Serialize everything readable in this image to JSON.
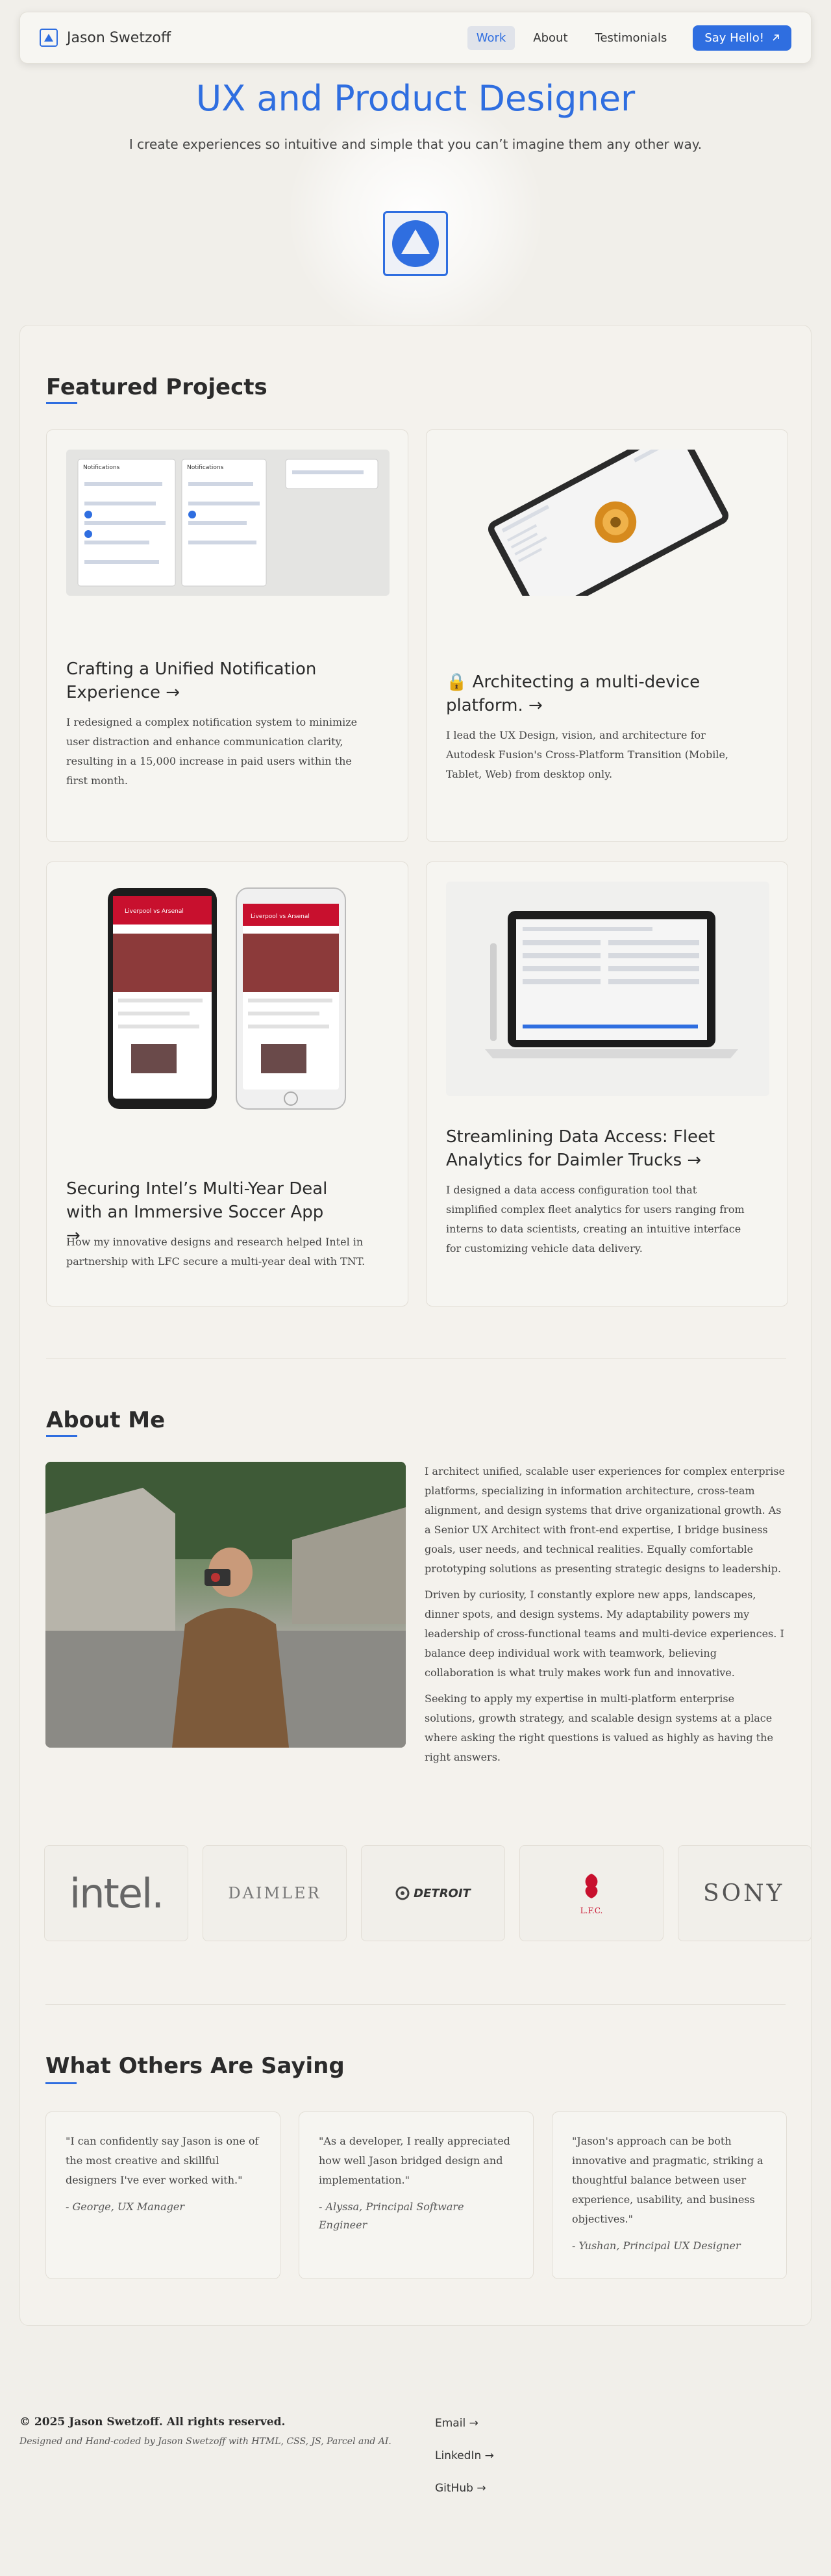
{
  "nav": {
    "name": "Jason Swetzoff",
    "links": [
      "Work",
      "About",
      "Testimonials"
    ],
    "cta": "Say Hello!",
    "cta_icon": "arrow-up-right-icon"
  },
  "hero": {
    "title": "UX and Product Designer",
    "subtitle": "I create experiences so intuitive and simple that you can’t imagine them any other way."
  },
  "featured": {
    "title": "Featured Projects",
    "projects": [
      {
        "title": "Crafting a Unified Notification Experience →",
        "desc": "I redesigned a complex notification system to minimize user distraction and enhance communication clarity, resulting in a 15,000 increase in paid users within the first month."
      },
      {
        "title": "🔒 Architecting a multi-device platform. →",
        "desc": "I lead the UX Design, vision, and architecture for Autodesk Fusion's Cross-Platform Transition (Mobile, Tablet, Web) from desktop only."
      },
      {
        "title": "Securing Intel’s Multi-Year Deal with an Immersive Soccer App →",
        "desc": "How my innovative designs and research helped Intel in partnership with LFC secure a multi-year deal with TNT."
      },
      {
        "title": "Streamlining Data Access: Fleet Analytics for Daimler Trucks →",
        "desc": "I designed a data access configuration tool that simplified complex fleet analytics for users ranging from interns to data scientists, creating an intuitive interface for customizing vehicle data delivery."
      }
    ],
    "thumb_labels": {
      "notifications": "Notifications",
      "liverpool": "Liverpool vs Arsenal"
    }
  },
  "about": {
    "title": "About Me",
    "paragraphs": [
      "I architect unified, scalable user experiences for complex enterprise platforms, specializing in information architecture, cross-team alignment, and design systems that drive organizational growth. As a Senior UX Architect with front-end expertise, I bridge business goals, user needs, and technical realities. Equally comfortable prototyping solutions as presenting strategic designs to leadership.",
      "Driven by curiosity, I constantly explore new apps, landscapes, dinner spots, and design systems. My adaptability powers my leadership of cross-functional teams and multi-device experiences. I balance deep individual work with teamwork, believing collaboration is what truly makes work fun and innovative.",
      "Seeking to apply my expertise in multi-platform enterprise solutions, growth strategy, and scalable design systems at a place where asking the right questions is valued as highly as having the right answers."
    ]
  },
  "clients": [
    "intel.",
    "DAIMLER",
    "DETROIT",
    "L.F.C.",
    "SONY"
  ],
  "testimonials": {
    "title": "What Others Are Saying",
    "items": [
      {
        "quote": "\"I can confidently say Jason is one of the most creative and skillful designers I've ever worked with.\"",
        "author": "- George, UX Manager"
      },
      {
        "quote": "\"As a developer, I really appreciated how well Jason bridged design and implementation.\"",
        "author": "- Alyssa, Principal Software Engineer"
      },
      {
        "quote": "\"Jason's approach can be both innovative and pragmatic, striking a thoughtful balance between user experience, usability, and business objectives.\"",
        "author": "- Yushan, Principal UX Designer"
      }
    ]
  },
  "footer": {
    "copyright": "© 2025 Jason Swetzoff. All rights reserved.",
    "note": "Designed and Hand-coded by Jason Swetzoff with HTML, CSS, JS, Parcel and AI.",
    "links": [
      "Email →",
      "LinkedIn →",
      "GitHub →"
    ]
  },
  "colors": {
    "accent": "#2f6ee0",
    "background": "#f1efea",
    "lfc_red": "#c8102e"
  }
}
